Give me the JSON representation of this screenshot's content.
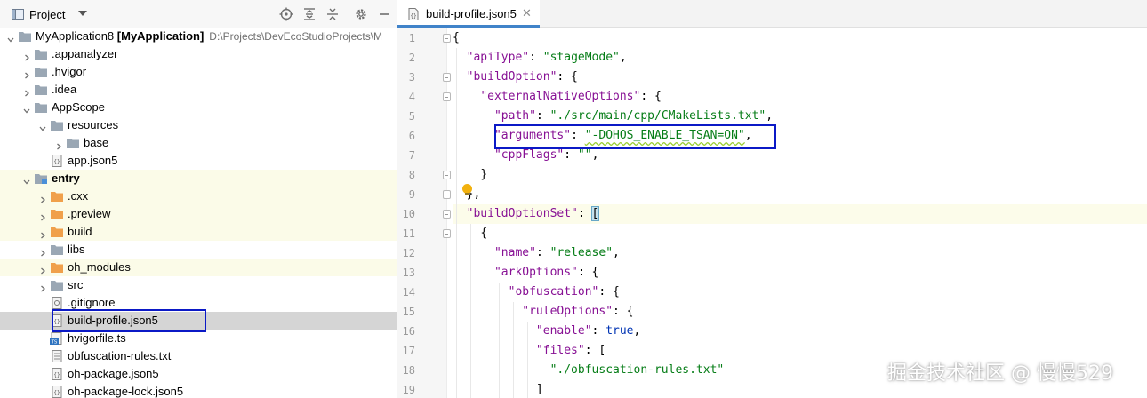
{
  "project_panel": {
    "title": "Project",
    "tree": [
      {
        "label": "MyApplication8",
        "bold_suffix": "[MyApplication]",
        "path": "D:\\Projects\\DevEcoStudioProjects\\M",
        "indent": 0,
        "expanded": true,
        "icon": "folder-icon",
        "excluded": false
      },
      {
        "label": ".appanalyzer",
        "indent": 1,
        "expanded": false,
        "icon": "folder-icon",
        "excluded": false
      },
      {
        "label": ".hvigor",
        "indent": 1,
        "expanded": false,
        "icon": "folder-icon",
        "excluded": false
      },
      {
        "label": ".idea",
        "indent": 1,
        "expanded": false,
        "icon": "folder-icon",
        "excluded": false
      },
      {
        "label": "AppScope",
        "indent": 1,
        "expanded": true,
        "icon": "folder-icon",
        "excluded": false
      },
      {
        "label": "resources",
        "indent": 2,
        "expanded": true,
        "icon": "folder-icon",
        "excluded": false
      },
      {
        "label": "base",
        "indent": 3,
        "expanded": false,
        "icon": "folder-icon",
        "excluded": false
      },
      {
        "label": "app.json5",
        "indent": 2,
        "icon": "json-file-icon",
        "excluded": false
      },
      {
        "label": "entry",
        "indent": 1,
        "expanded": true,
        "icon": "module-folder-icon",
        "excluded": true,
        "bold": true
      },
      {
        "label": ".cxx",
        "indent": 2,
        "expanded": false,
        "icon": "orange-folder-icon",
        "excluded": true
      },
      {
        "label": ".preview",
        "indent": 2,
        "expanded": false,
        "icon": "orange-folder-icon",
        "excluded": true
      },
      {
        "label": "build",
        "indent": 2,
        "expanded": false,
        "icon": "orange-folder-icon",
        "excluded": true
      },
      {
        "label": "libs",
        "indent": 2,
        "expanded": false,
        "icon": "folder-icon",
        "excluded": false
      },
      {
        "label": "oh_modules",
        "indent": 2,
        "expanded": false,
        "icon": "orange-folder-icon",
        "excluded": true
      },
      {
        "label": "src",
        "indent": 2,
        "expanded": false,
        "icon": "folder-icon",
        "excluded": false
      },
      {
        "label": ".gitignore",
        "indent": 2,
        "icon": "gitignore-file-icon",
        "excluded": false
      },
      {
        "label": "build-profile.json5",
        "indent": 2,
        "icon": "json-file-icon",
        "excluded": false,
        "selected": true
      },
      {
        "label": "hvigorfile.ts",
        "indent": 2,
        "icon": "ts-file-icon",
        "excluded": false
      },
      {
        "label": "obfuscation-rules.txt",
        "indent": 2,
        "icon": "text-file-icon",
        "excluded": false
      },
      {
        "label": "oh-package.json5",
        "indent": 2,
        "icon": "json-file-icon",
        "excluded": false
      },
      {
        "label": "oh-package-lock.json5",
        "indent": 2,
        "icon": "json-file-icon",
        "excluded": false
      }
    ]
  },
  "editor": {
    "tab_label": "build-profile.json5",
    "tab_close": "✕",
    "line_numbers": [
      "1",
      "2",
      "3",
      "4",
      "5",
      "6",
      "7",
      "8",
      "9",
      "10",
      "11",
      "12",
      "13",
      "14",
      "15",
      "16",
      "17",
      "18",
      "19"
    ],
    "lines": [
      {
        "indent": 0,
        "tokens": [
          [
            "p",
            "{"
          ]
        ]
      },
      {
        "indent": 1,
        "tokens": [
          [
            "k",
            "\"apiType\""
          ],
          [
            "p",
            ": "
          ],
          [
            "s",
            "\"stageMode\""
          ],
          [
            "p",
            ","
          ]
        ]
      },
      {
        "indent": 1,
        "tokens": [
          [
            "k",
            "\"buildOption\""
          ],
          [
            "p",
            ": {"
          ]
        ]
      },
      {
        "indent": 2,
        "tokens": [
          [
            "k",
            "\"externalNativeOptions\""
          ],
          [
            "p",
            ": {"
          ]
        ]
      },
      {
        "indent": 3,
        "tokens": [
          [
            "k",
            "\"path\""
          ],
          [
            "p",
            ": "
          ],
          [
            "s",
            "\"./src/main/cpp/CMakeLists.txt\""
          ],
          [
            "p",
            ","
          ]
        ]
      },
      {
        "indent": 3,
        "tokens": [
          [
            "k",
            "\"arguments\""
          ],
          [
            "p",
            ": "
          ],
          [
            "sq",
            "\"-DOHOS_ENABLE_TSAN=ON\""
          ],
          [
            "p",
            ","
          ]
        ]
      },
      {
        "indent": 3,
        "tokens": [
          [
            "k",
            "\"cppFlags\""
          ],
          [
            "p",
            ": "
          ],
          [
            "s",
            "\"\""
          ],
          [
            "p",
            ","
          ]
        ]
      },
      {
        "indent": 2,
        "tokens": [
          [
            "p",
            "}"
          ]
        ]
      },
      {
        "indent": 1,
        "tokens": [
          [
            "p",
            "},"
          ]
        ]
      },
      {
        "indent": 1,
        "tokens": [
          [
            "k",
            "\"buildOptionSet\""
          ],
          [
            "p",
            ": "
          ],
          [
            "hl",
            "["
          ]
        ]
      },
      {
        "indent": 2,
        "tokens": [
          [
            "p",
            "{"
          ]
        ]
      },
      {
        "indent": 3,
        "tokens": [
          [
            "k",
            "\"name\""
          ],
          [
            "p",
            ": "
          ],
          [
            "s",
            "\"release\""
          ],
          [
            "p",
            ","
          ]
        ]
      },
      {
        "indent": 3,
        "tokens": [
          [
            "k",
            "\"arkOptions\""
          ],
          [
            "p",
            ": {"
          ]
        ]
      },
      {
        "indent": 4,
        "tokens": [
          [
            "k",
            "\"obfuscation\""
          ],
          [
            "p",
            ": {"
          ]
        ]
      },
      {
        "indent": 5,
        "tokens": [
          [
            "k",
            "\"ruleOptions\""
          ],
          [
            "p",
            ": {"
          ]
        ]
      },
      {
        "indent": 6,
        "tokens": [
          [
            "k",
            "\"enable\""
          ],
          [
            "p",
            ": "
          ],
          [
            "b",
            "true"
          ],
          [
            "p",
            ","
          ]
        ]
      },
      {
        "indent": 6,
        "tokens": [
          [
            "k",
            "\"files\""
          ],
          [
            "p",
            ": ["
          ]
        ]
      },
      {
        "indent": 7,
        "tokens": [
          [
            "s",
            "\"./obfuscation-rules.txt\""
          ]
        ]
      },
      {
        "indent": 6,
        "tokens": [
          [
            "p",
            "]"
          ]
        ]
      }
    ],
    "current_line": 10
  },
  "watermark": "掘金技术社区 @ 慢慢529",
  "colors": {
    "key": "#871094",
    "string": "#067d17",
    "keyword": "#0033b3",
    "highlight_box": "#0b19c6",
    "selected_row": "#d5d5d5",
    "excluded_row": "#fbfbe8"
  }
}
